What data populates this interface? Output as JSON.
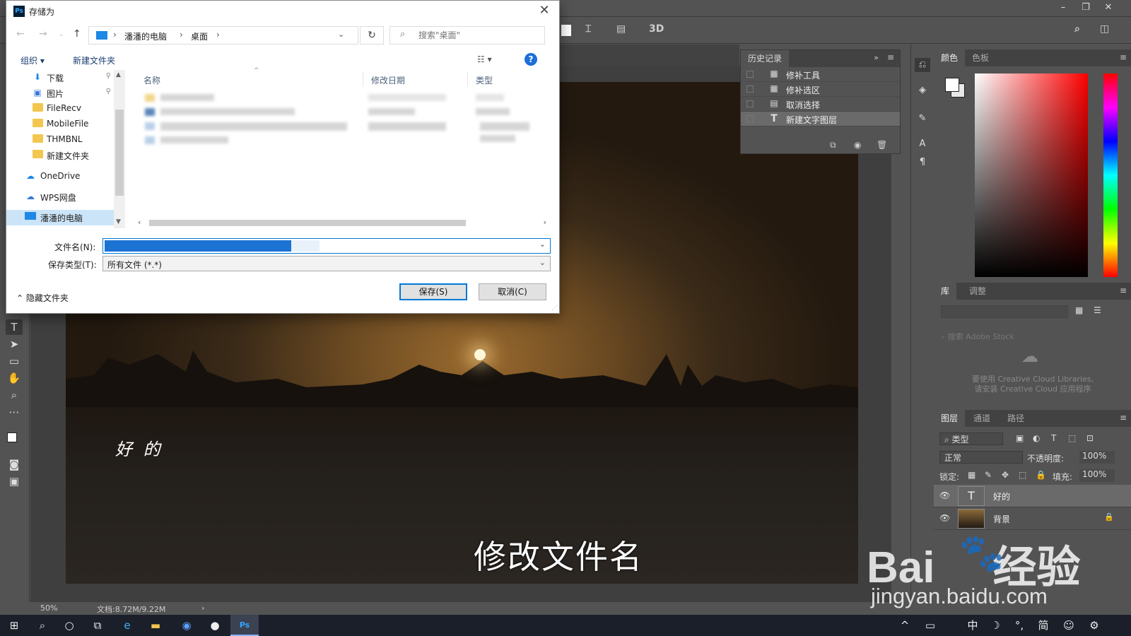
{
  "photoshop": {
    "options_bar": {
      "mode_3d": "3D"
    },
    "history": {
      "tab": "历史记录",
      "items": [
        {
          "label": "修补工具",
          "icon": "patch-icon"
        },
        {
          "label": "修补选区",
          "icon": "patch-icon"
        },
        {
          "label": "取消选择",
          "icon": "document-icon"
        },
        {
          "label": "新建文字图层",
          "icon": "type-icon",
          "selected": true
        }
      ]
    },
    "color_panel": {
      "tabs": [
        "颜色",
        "色板"
      ]
    },
    "library_panel": {
      "tabs": [
        "库",
        "调整"
      ],
      "search_placeholder": "搜索 Adobe Stock",
      "message_line1": "要使用 Creative Cloud Libraries,",
      "message_line2": "请安装 Creative Cloud 应用程序"
    },
    "layers_panel": {
      "tabs": [
        "图层",
        "通道",
        "路径"
      ],
      "filter": "类型",
      "blend_mode": "正常",
      "opacity_label": "不透明度:",
      "opacity_value": "100%",
      "lock_label": "锁定:",
      "fill_label": "填充:",
      "fill_value": "100%",
      "layers": [
        {
          "name": "好的",
          "type": "text",
          "selected": true
        },
        {
          "name": "背景",
          "type": "image",
          "locked": true
        }
      ]
    },
    "canvas_text": "好 的",
    "status": {
      "zoom": "50%",
      "doc": "文档:8.72M/9.22M"
    }
  },
  "dialog": {
    "title": "存储为",
    "address": {
      "crumbs": [
        "潘潘的电脑",
        "桌面"
      ]
    },
    "search": {
      "placeholder": "搜索\"桌面\""
    },
    "commands": {
      "organize": "组织 ▾",
      "new_folder": "新建文件夹"
    },
    "nav_items": [
      {
        "label": "下载",
        "icon": "download-icon",
        "pinned": true
      },
      {
        "label": "图片",
        "icon": "pictures-icon",
        "pinned": true
      },
      {
        "label": "FileRecv",
        "icon": "folder-icon"
      },
      {
        "label": "MobileFile",
        "icon": "folder-icon"
      },
      {
        "label": "THMBNL",
        "icon": "folder-icon"
      },
      {
        "label": "新建文件夹",
        "icon": "folder-icon"
      },
      {
        "label": "OneDrive",
        "icon": "cloud-icon"
      },
      {
        "label": "WPS网盘",
        "icon": "cloud-icon"
      },
      {
        "label": "潘潘的电脑",
        "icon": "computer-icon",
        "selected": true
      }
    ],
    "columns": [
      "名称",
      "修改日期",
      "类型"
    ],
    "filename_label": "文件名(N):",
    "filename_value": "",
    "filetype_label": "保存类型(T):",
    "filetype_value": "所有文件 (*.*)",
    "hide_folders": "隐藏文件夹",
    "save_button": "保存(S)",
    "cancel_button": "取消(C)"
  },
  "caption": "修改文件名",
  "watermark": {
    "brand": "Bai",
    "brand_suffix": "经验",
    "url": "jingyan.baidu.com"
  }
}
